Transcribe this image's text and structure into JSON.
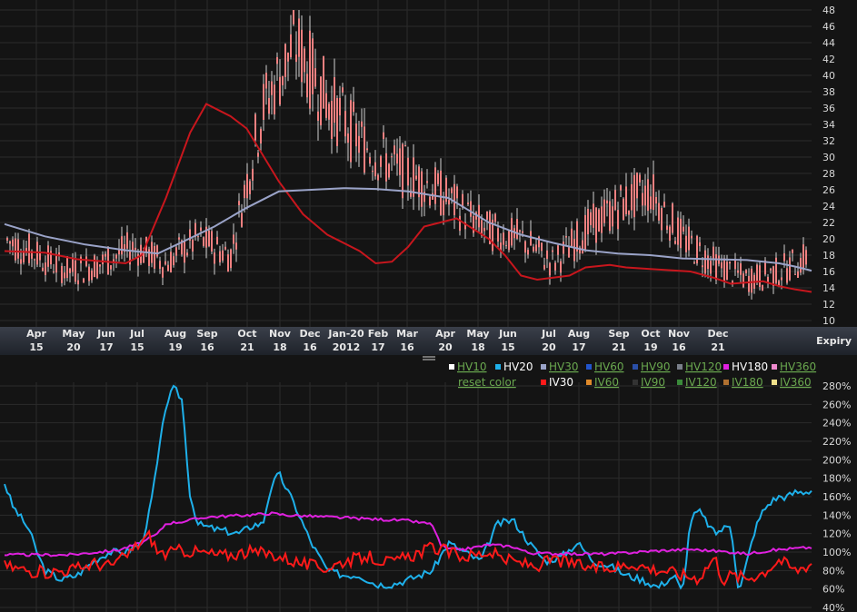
{
  "colors": {
    "background": "#141414",
    "grid": "#2b2b2b",
    "candle_body": "#f08080",
    "candle_wick": "#ffffff",
    "ma_short": "#c8161d",
    "ma_long": "#9aa3c8",
    "hv20": "#1eb0ea",
    "hv180": "#e020e0",
    "iv30": "#ff1a1a",
    "legend_link": "#6aa84f"
  },
  "expiry_label": "Expiry",
  "axis_months": [
    {
      "month": "Apr",
      "day": "15"
    },
    {
      "month": "May",
      "day": "20"
    },
    {
      "month": "Jun",
      "day": "17"
    },
    {
      "month": "Jul",
      "day": "15"
    },
    {
      "month": "Aug",
      "day": "19"
    },
    {
      "month": "Sep",
      "day": "16"
    },
    {
      "month": "Oct",
      "day": "21"
    },
    {
      "month": "Nov",
      "day": "18"
    },
    {
      "month": "Dec",
      "day": "16"
    },
    {
      "month": "Jan-20",
      "day": "2012"
    },
    {
      "month": "Feb",
      "day": "17"
    },
    {
      "month": "Mar",
      "day": "16"
    },
    {
      "month": "Apr",
      "day": "20"
    },
    {
      "month": "May",
      "day": "18"
    },
    {
      "month": "Jun",
      "day": "15"
    },
    {
      "month": "Jul",
      "day": "20"
    },
    {
      "month": "Aug",
      "day": "17"
    },
    {
      "month": "Sep",
      "day": "21"
    },
    {
      "month": "Oct",
      "day": "19"
    },
    {
      "month": "Nov",
      "day": "16"
    },
    {
      "month": "Dec",
      "day": "21"
    }
  ],
  "legend": {
    "row1": [
      {
        "label": "HV10",
        "active": false,
        "swatch": "#ffffff"
      },
      {
        "label": "HV20",
        "active": true,
        "swatch": "#1eb0ea"
      },
      {
        "label": "HV30",
        "active": false,
        "swatch": "#9aa3c8"
      },
      {
        "label": "HV60",
        "active": false,
        "swatch": "#2255cc"
      },
      {
        "label": "HV90",
        "active": false,
        "swatch": "#2a4fa8"
      },
      {
        "label": "HV120",
        "active": false,
        "swatch": "#7a7f8a"
      },
      {
        "label": "HV180",
        "active": true,
        "swatch": "#e020e0"
      },
      {
        "label": "HV360",
        "active": false,
        "swatch": "#ee88cc"
      }
    ],
    "reset": "reset color",
    "row2": [
      {
        "label": "IV30",
        "active": true,
        "swatch": "#ff1a1a"
      },
      {
        "label": "IV60",
        "active": false,
        "swatch": "#e08a2a"
      },
      {
        "label": "IV90",
        "active": false,
        "swatch": "#333333"
      },
      {
        "label": "IV120",
        "active": false,
        "swatch": "#3a8a3a"
      },
      {
        "label": "IV180",
        "active": false,
        "swatch": "#b07030"
      },
      {
        "label": "IV360",
        "active": false,
        "swatch": "#f0e08a"
      }
    ]
  },
  "chart_data": [
    {
      "type": "line",
      "name": "price",
      "x_range": [
        0,
        100
      ],
      "ylim": [
        10,
        48
      ],
      "yticks": [
        10,
        12,
        14,
        16,
        18,
        20,
        22,
        24,
        26,
        28,
        30,
        32,
        34,
        36,
        38,
        40,
        42,
        44,
        46,
        48
      ],
      "grid": true,
      "candles": {
        "x": [
          0,
          4,
          8,
          12,
          16,
          20,
          24,
          28,
          32,
          36,
          40,
          44,
          48,
          52,
          56,
          60,
          64,
          68,
          72,
          76,
          80,
          84,
          88,
          92,
          96,
          100
        ],
        "values": [
          20,
          18,
          16,
          17,
          19,
          17,
          20,
          18,
          36,
          44,
          37,
          32,
          29,
          27,
          24,
          21,
          20,
          17,
          21,
          24,
          26,
          20,
          17,
          15,
          16,
          18
        ]
      },
      "series": [
        {
          "color_key": "ma_short",
          "x": [
            0,
            5,
            9,
            15,
            17,
            20,
            23,
            25,
            28,
            30,
            34,
            37,
            40,
            44,
            46,
            48,
            50,
            52,
            56,
            60,
            62,
            64,
            66,
            70,
            72,
            75,
            77,
            80,
            85,
            88,
            90,
            94,
            96,
            98,
            100
          ],
          "values": [
            18.5,
            18.3,
            17.5,
            17,
            18,
            25,
            33,
            36.5,
            35,
            33.5,
            27,
            23,
            20.5,
            18.5,
            17,
            17.2,
            19,
            21.5,
            22.5,
            20,
            18,
            15.5,
            15,
            15.5,
            16.5,
            16.8,
            16.5,
            16.3,
            16,
            15.2,
            14.5,
            14.8,
            14.2,
            13.8,
            13.5
          ]
        },
        {
          "color_key": "ma_long",
          "x": [
            0,
            5,
            10,
            15,
            19,
            22,
            26,
            30,
            34,
            38,
            42,
            46,
            50,
            55,
            60,
            64,
            68,
            72,
            76,
            80,
            84,
            88,
            92,
            96,
            98,
            100
          ],
          "values": [
            21.8,
            20.3,
            19.3,
            18.6,
            18.2,
            19.6,
            21.5,
            23.8,
            25.8,
            26,
            26.2,
            26.1,
            25.8,
            25,
            22,
            20.5,
            19.5,
            18.6,
            18.2,
            18,
            17.6,
            17.5,
            17.4,
            17,
            16.6,
            16.1
          ]
        }
      ]
    },
    {
      "type": "line",
      "name": "volatility",
      "x_range": [
        0,
        100
      ],
      "ylim": [
        40,
        280
      ],
      "yticks": [
        "40%",
        "60%",
        "80%",
        "100%",
        "120%",
        "140%",
        "160%",
        "180%",
        "200%",
        "220%",
        "240%",
        "260%",
        "280%"
      ],
      "grid": true,
      "series": [
        {
          "name": "HV20",
          "color_key": "hv20",
          "x": [
            0,
            1,
            3,
            4,
            5,
            7,
            9,
            11,
            13,
            15,
            17,
            18,
            19,
            20,
            21,
            22,
            23,
            24,
            26,
            29,
            31,
            32,
            33,
            34,
            36,
            38,
            40,
            42,
            44,
            46,
            48,
            50,
            53,
            55,
            57,
            59,
            61,
            63,
            65,
            67,
            69,
            71,
            73,
            75,
            77,
            79,
            81,
            83,
            84,
            85,
            86,
            88,
            90,
            91,
            93,
            94,
            95,
            96,
            97,
            98,
            99,
            100
          ],
          "values": [
            175,
            150,
            125,
            100,
            80,
            70,
            75,
            90,
            100,
            100,
            110,
            145,
            200,
            260,
            278,
            265,
            160,
            130,
            125,
            120,
            130,
            130,
            170,
            185,
            150,
            110,
            80,
            75,
            75,
            65,
            65,
            70,
            80,
            110,
            100,
            90,
            130,
            135,
            110,
            90,
            95,
            110,
            90,
            85,
            75,
            70,
            62,
            75,
            55,
            135,
            145,
            120,
            130,
            55,
            125,
            145,
            155,
            160,
            160,
            165,
            165,
            167
          ]
        },
        {
          "name": "HV180",
          "color_key": "hv180",
          "x": [
            0,
            8,
            14,
            17,
            19,
            20,
            22,
            25,
            30,
            33,
            35,
            40,
            45,
            50,
            53,
            54,
            55,
            57,
            60,
            63,
            65,
            70,
            75,
            80,
            85,
            90,
            92,
            95,
            98,
            100
          ],
          "values": [
            97,
            97,
            102,
            110,
            120,
            131,
            133,
            138,
            140,
            142,
            140,
            138,
            136,
            134,
            130,
            108,
            103,
            103,
            108,
            106,
            99,
            98,
            98,
            101,
            103,
            100,
            98,
            102,
            104,
            105
          ]
        },
        {
          "name": "IV30",
          "color_key": "iv30",
          "x": [
            0,
            3,
            5,
            7,
            9,
            11,
            13,
            15,
            17,
            18,
            19,
            20,
            22,
            24,
            27,
            30,
            33,
            36,
            38,
            40,
            42,
            45,
            48,
            50,
            53,
            55,
            57,
            60,
            62,
            64,
            66,
            68,
            70,
            72,
            74,
            76,
            78,
            80,
            82,
            84,
            86,
            88,
            89,
            90,
            92,
            94,
            96,
            98,
            100
          ],
          "values": [
            85,
            80,
            78,
            80,
            82,
            88,
            85,
            95,
            112,
            118,
            100,
            98,
            102,
            100,
            96,
            100,
            98,
            90,
            85,
            83,
            90,
            95,
            88,
            95,
            105,
            100,
            95,
            100,
            92,
            88,
            85,
            92,
            88,
            84,
            82,
            84,
            88,
            82,
            80,
            75,
            72,
            95,
            70,
            75,
            72,
            78,
            92,
            80,
            88
          ]
        }
      ]
    }
  ]
}
